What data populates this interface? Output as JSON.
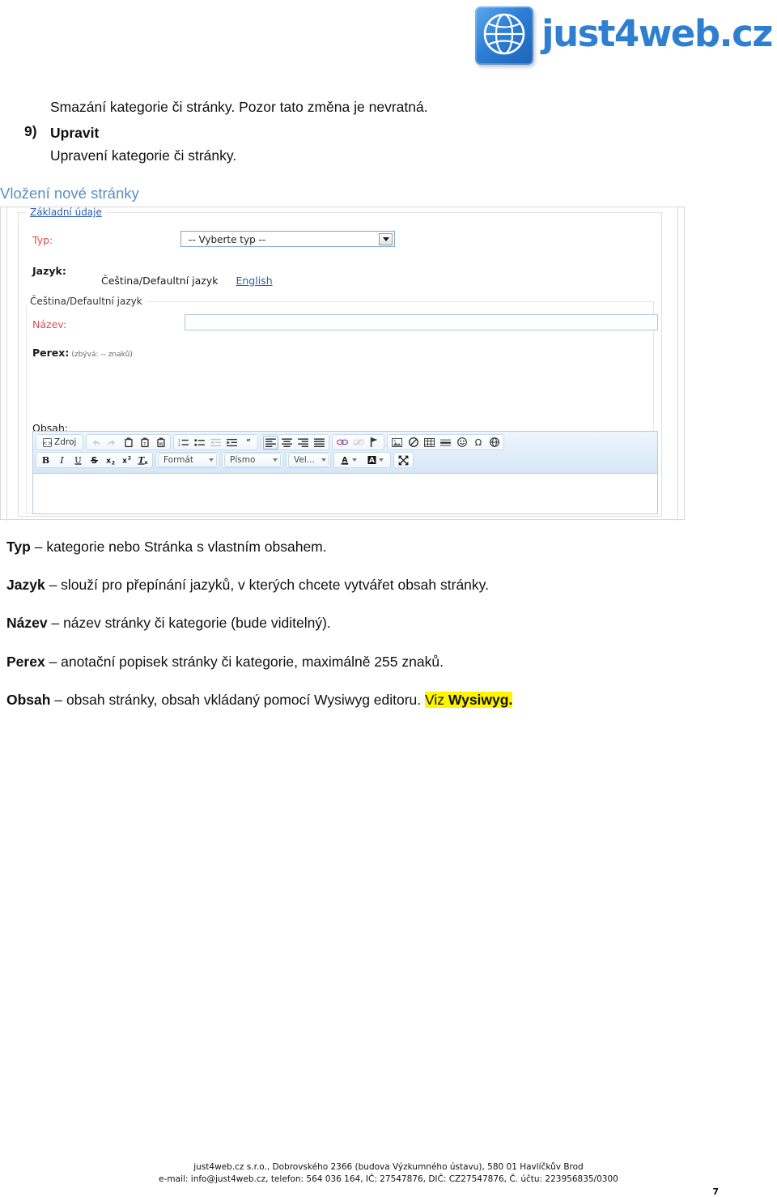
{
  "header": {
    "logo_text": "just4web.cz",
    "logo_icon": "globe-icon"
  },
  "document": {
    "intro_line": "Smazání kategorie či stránky. Pozor tato změna je nevratná.",
    "list_item": {
      "marker": "9)",
      "title": "Upravit",
      "description": "Upravení kategorie či stránky."
    },
    "section_heading": "Vložení nové stránky",
    "definitions": [
      {
        "term": "Typ",
        "dash": "–",
        "text": "kategorie nebo Stránka s vlastním obsahem."
      },
      {
        "term": "Jazyk",
        "dash": "–",
        "text": "slouží pro přepínání jazyků, v kterých chcete vytvářet obsah stránky."
      },
      {
        "term": "Název",
        "dash": "–",
        "text": "název stránky či kategorie (bude viditelný)."
      },
      {
        "term": "Perex",
        "dash": "–",
        "text": "anotační popisek stránky či kategorie, maximálně 255 znaků."
      },
      {
        "term": "Obsah",
        "dash": "–",
        "text": "obsah stránky, obsah vkládaný pomocí Wysiwyg editoru."
      }
    ],
    "highlight_text": "Viz ",
    "highlight_bold": "Wysiwyg."
  },
  "screenshot": {
    "fieldset_basic_legend": "Základní údaje",
    "fieldset_lang_legend": "Čeština/Defaultní jazyk",
    "labels": {
      "typ": "Typ:",
      "jazyk": "Jazyk:",
      "nazev": "Název:",
      "perex": "Perex:",
      "perex_hint": "(zbývá: -- znaků)",
      "obsah": "Obsah:"
    },
    "type_select": {
      "value": "-- Vyberte typ --",
      "arrow_icon": "chevron-down-icon"
    },
    "language_tabs": [
      {
        "label": "Čeština/Defaultní jazyk",
        "active": true
      },
      {
        "label": "English",
        "active": false
      }
    ],
    "nazev_value": "",
    "perex_value": "",
    "editor": {
      "source_button_label": "Zdroj",
      "combos": {
        "format": "Formát",
        "font": "Písmo",
        "size": "Vel..."
      },
      "row1_icons": [
        "source-icon",
        "undo-icon",
        "redo-icon",
        "paste-icon",
        "paste-text-icon",
        "paste-word-icon",
        "numbered-list-icon",
        "bulleted-list-icon",
        "outdent-icon",
        "indent-icon",
        "blockquote-icon",
        "align-left-icon",
        "align-center-icon",
        "align-right-icon",
        "align-justify-icon",
        "link-icon",
        "unlink-icon",
        "anchor-icon",
        "image-icon",
        "flash-icon",
        "table-icon",
        "horizontal-rule-icon",
        "smiley-icon",
        "special-char-icon",
        "iframe-icon"
      ],
      "row2_icons": [
        "bold-icon",
        "italic-icon",
        "underline-icon",
        "strikethrough-icon",
        "subscript-icon",
        "superscript-icon",
        "remove-format-icon",
        "text-color-icon",
        "background-color-icon",
        "maximize-icon"
      ]
    }
  },
  "footer": {
    "line1": "just4web.cz s.r.o., Dobrovského 2366 (budova Výzkumného ústavu), 580 01 Havlíčkův Brod",
    "line2": "e-mail: info@just4web.cz, telefon: 564 036 164, IČ: 27547876, DIČ: CZ27547876, Č. účtu: 223956835/0300",
    "page_number": "7"
  },
  "colors": {
    "brand_blue": "#2f7fd1",
    "heading_blue": "#5b8fbe",
    "required_red": "#d9534f",
    "link_blue": "#2a5db0",
    "highlight_yellow": "#fff500"
  }
}
